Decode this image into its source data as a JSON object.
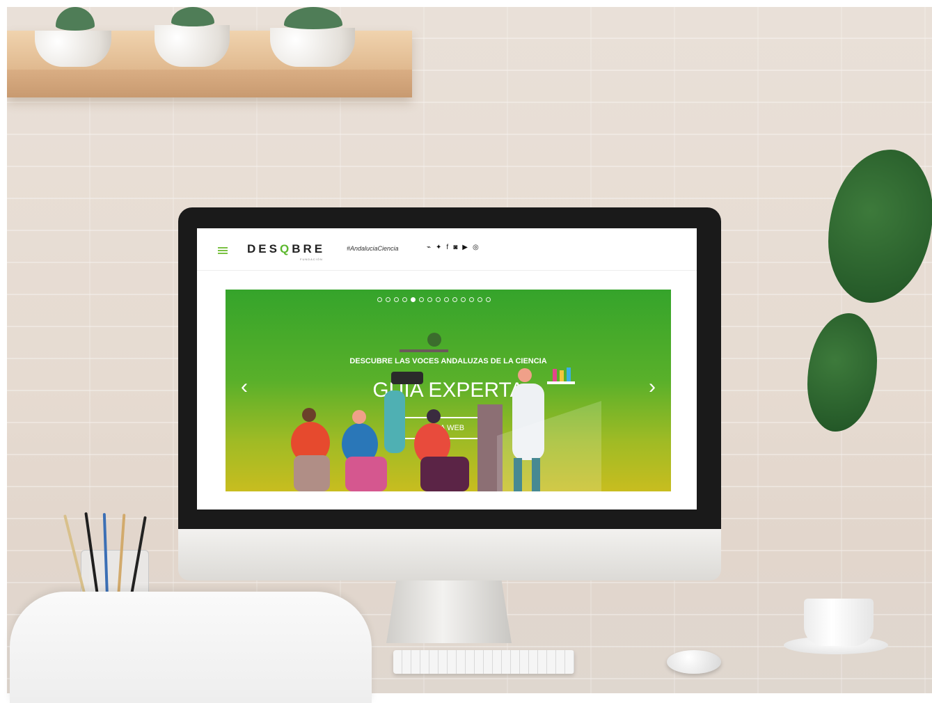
{
  "site": {
    "logo_text": "DES",
    "logo_q": "Q",
    "logo_rest": "BRE",
    "logo_sub": "FUNDACIÓN",
    "hashtag": "#AndaluciaCiencia",
    "social_icons": [
      "rss-icon",
      "twitter-icon",
      "facebook-icon",
      "flickr-icon",
      "youtube-icon",
      "instagram-icon"
    ]
  },
  "hero": {
    "kicker": "DESCUBRE LAS VOCES ANDALUZAS DE LA CIENCIA",
    "title": "GUÍA EXPERTA",
    "cta_label": "IR A WEB",
    "slide_count": 14,
    "active_slide": 5,
    "prev_symbol": "‹",
    "next_symbol": "›"
  },
  "colors": {
    "brand_green": "#5cb82e",
    "hero_top": "#35a42b",
    "hero_bottom": "#c8bd1f"
  }
}
